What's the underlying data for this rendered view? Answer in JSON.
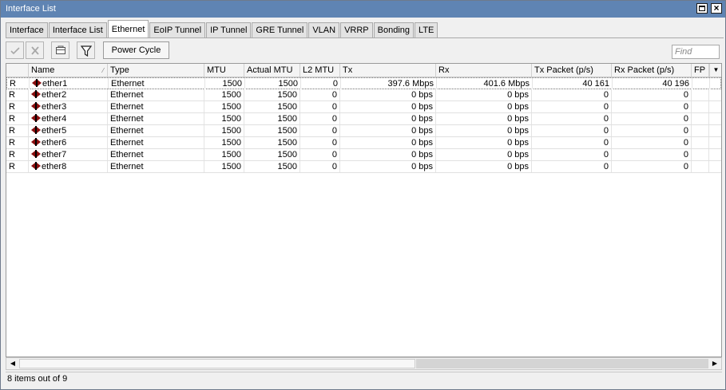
{
  "window": {
    "title": "Interface List"
  },
  "tabs": [
    "Interface",
    "Interface List",
    "Ethernet",
    "EoIP Tunnel",
    "IP Tunnel",
    "GRE Tunnel",
    "VLAN",
    "VRRP",
    "Bonding",
    "LTE"
  ],
  "toolbar": {
    "power_cycle_label": "Power Cycle",
    "find_placeholder": "Find"
  },
  "table": {
    "headers": {
      "flag": "",
      "name": "Name",
      "type": "Type",
      "mtu": "MTU",
      "actual_mtu": "Actual MTU",
      "l2_mtu": "L2 MTU",
      "tx": "Tx",
      "rx": "Rx",
      "tx_packet": "Tx Packet (p/s)",
      "rx_packet": "Rx Packet (p/s)",
      "fp": "FP"
    },
    "rows": [
      {
        "flag": "R",
        "name": "ether1",
        "type": "Ethernet",
        "mtu": "1500",
        "actual_mtu": "1500",
        "l2_mtu": "0",
        "tx": "397.6 Mbps",
        "rx": "401.6 Mbps",
        "tx_packet": "40 161",
        "rx_packet": "40 196"
      },
      {
        "flag": "R",
        "name": "ether2",
        "type": "Ethernet",
        "mtu": "1500",
        "actual_mtu": "1500",
        "l2_mtu": "0",
        "tx": "0 bps",
        "rx": "0 bps",
        "tx_packet": "0",
        "rx_packet": "0"
      },
      {
        "flag": "R",
        "name": "ether3",
        "type": "Ethernet",
        "mtu": "1500",
        "actual_mtu": "1500",
        "l2_mtu": "0",
        "tx": "0 bps",
        "rx": "0 bps",
        "tx_packet": "0",
        "rx_packet": "0"
      },
      {
        "flag": "R",
        "name": "ether4",
        "type": "Ethernet",
        "mtu": "1500",
        "actual_mtu": "1500",
        "l2_mtu": "0",
        "tx": "0 bps",
        "rx": "0 bps",
        "tx_packet": "0",
        "rx_packet": "0"
      },
      {
        "flag": "R",
        "name": "ether5",
        "type": "Ethernet",
        "mtu": "1500",
        "actual_mtu": "1500",
        "l2_mtu": "0",
        "tx": "0 bps",
        "rx": "0 bps",
        "tx_packet": "0",
        "rx_packet": "0"
      },
      {
        "flag": "R",
        "name": "ether6",
        "type": "Ethernet",
        "mtu": "1500",
        "actual_mtu": "1500",
        "l2_mtu": "0",
        "tx": "0 bps",
        "rx": "0 bps",
        "tx_packet": "0",
        "rx_packet": "0"
      },
      {
        "flag": "R",
        "name": "ether7",
        "type": "Ethernet",
        "mtu": "1500",
        "actual_mtu": "1500",
        "l2_mtu": "0",
        "tx": "0 bps",
        "rx": "0 bps",
        "tx_packet": "0",
        "rx_packet": "0"
      },
      {
        "flag": "R",
        "name": "ether8",
        "type": "Ethernet",
        "mtu": "1500",
        "actual_mtu": "1500",
        "l2_mtu": "0",
        "tx": "0 bps",
        "rx": "0 bps",
        "tx_packet": "0",
        "rx_packet": "0"
      }
    ]
  },
  "status": {
    "text": "8 items out of 9"
  }
}
